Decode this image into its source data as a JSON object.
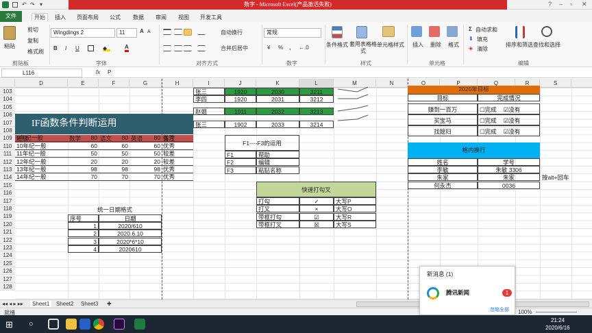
{
  "title": {
    "text": "数字 - Microsoft Excel(产品激活失败)",
    "qat": [
      "↶",
      "↷",
      "▾"
    ],
    "controls": [
      "?",
      "–",
      "▫",
      "✕"
    ]
  },
  "tabs": {
    "file": "文件",
    "items": [
      "开始",
      "插入",
      "页面布局",
      "公式",
      "数据",
      "审阅",
      "视图",
      "开发工具"
    ]
  },
  "ribbon": {
    "paste": "粘贴",
    "cut": "剪切",
    "copy": "复制",
    "format_painter": "格式刷",
    "font_name": "Wingdings 2",
    "font_size": "11",
    "bold": "B",
    "italic": "I",
    "underline": "U",
    "wrap": "自动换行",
    "merge": "合并后居中",
    "number_format": "常规",
    "cond_format": "条件格式",
    "table_format": "套用表格格式",
    "cell_style": "单元格样式",
    "insert": "插入",
    "delete": "删除",
    "format": "格式",
    "autosum": "自动求和",
    "fill": "填充",
    "clear": "清除",
    "sort": "排序和筛选",
    "find": "查找和选择",
    "groups": [
      "剪贴板",
      "字体",
      "对齐方式",
      "数字",
      "样式",
      "单元格",
      "编辑"
    ],
    "pct": "%",
    "comma": ","
  },
  "formula_bar": {
    "name_box": "L116",
    "fx": "fx",
    "content": "P"
  },
  "columns": [
    "D",
    "E",
    "F",
    "G",
    "H",
    "I",
    "J",
    "K",
    "L",
    "M",
    "N",
    "O",
    "P",
    "Q",
    "R",
    "S"
  ],
  "rows": [
    "103",
    "104",
    "105",
    "106",
    "107",
    "108",
    "109",
    "110",
    "111",
    "112",
    "113",
    "114",
    "115",
    "116",
    "117",
    "118",
    "119",
    "120",
    "121",
    "122",
    "123",
    "124",
    "125",
    "126",
    "127",
    "128"
  ],
  "if_table": {
    "title": "IF函数条件判断运用",
    "headers": [
      "班级",
      "数学",
      "语文",
      "英语",
      "备注"
    ],
    "rows": [
      [
        "9年纪一般",
        "80",
        "80",
        "80",
        "优秀"
      ],
      [
        "10年纪一般",
        "60",
        "60",
        "60",
        "优秀"
      ],
      [
        "11年纪一般",
        "50",
        "50",
        "50",
        "较差"
      ],
      [
        "12年纪一般",
        "20",
        "20",
        "20",
        "较差"
      ],
      [
        "13年纪一般",
        "98",
        "98",
        "98",
        "优秀"
      ],
      [
        "14年纪一般",
        "70",
        "70",
        "70",
        "优秀"
      ]
    ]
  },
  "jl_table": [
    [
      "张三",
      "1920",
      "2030",
      "3211"
    ],
    [
      "李四",
      "1920",
      "2031",
      "3212"
    ],
    [
      "赵姐",
      "1911",
      "2032",
      "3213"
    ],
    [
      "张三",
      "1902",
      "2033",
      "3214"
    ]
  ],
  "f_keys": {
    "title": "F1----F3的运用",
    "rows": [
      [
        "F1",
        "帮助"
      ],
      [
        "F2",
        "编辑"
      ],
      [
        "F3",
        "粘贴名称"
      ]
    ]
  },
  "quick": {
    "title": "快速打勾叉",
    "rows": [
      [
        "打勾",
        "✓",
        "大写P"
      ],
      [
        "打叉",
        "×",
        "大写O"
      ],
      [
        "带框打勾",
        "☑",
        "大写R"
      ],
      [
        "带框打叉",
        "☒",
        "大写S"
      ]
    ]
  },
  "date": {
    "title": "统一日期格式",
    "headers": [
      "序号",
      "日期"
    ],
    "rows": [
      [
        "1",
        "2020/610"
      ],
      [
        "2",
        "2020.6.10"
      ],
      [
        "3",
        "2020*6*10"
      ],
      [
        "4",
        "2020610"
      ]
    ]
  },
  "plan": {
    "banner": "2020年目标",
    "headers": [
      "目标",
      "完成情况"
    ],
    "rows": [
      [
        "赚到一百万",
        "完成",
        "没有"
      ],
      [
        "买宝马",
        "完成",
        "没有"
      ],
      [
        "找媳妇",
        "完成",
        "没有"
      ]
    ]
  },
  "wrap": {
    "title": "格内换行",
    "headers": [
      "姓名",
      "学号"
    ],
    "rows": [
      [
        "李敏",
        "朱敏  3306"
      ],
      [
        "朱家",
        "朱家"
      ],
      [
        "何永杰",
        "0036"
      ]
    ],
    "note": "按alt+回车"
  },
  "sheets": [
    "Sheet1",
    "Sheet2",
    "Sheet3"
  ],
  "status": {
    "ready": "就绪",
    "zoom": "100%"
  },
  "notification": {
    "header": "新消息 (1)",
    "app": "腾讯新闻",
    "count": "1",
    "action": "忽略全部"
  },
  "clock": {
    "time": "21:24",
    "date": "2020/6/16"
  },
  "colors": {
    "green": "#2b9a41",
    "title_bar": "#d32b2b",
    "if_title": "#2d5f6f",
    "header_red": "#c0504d",
    "orange": "#e26b0a",
    "blue": "#00b0f0",
    "quick_green": "#c4d79b"
  }
}
